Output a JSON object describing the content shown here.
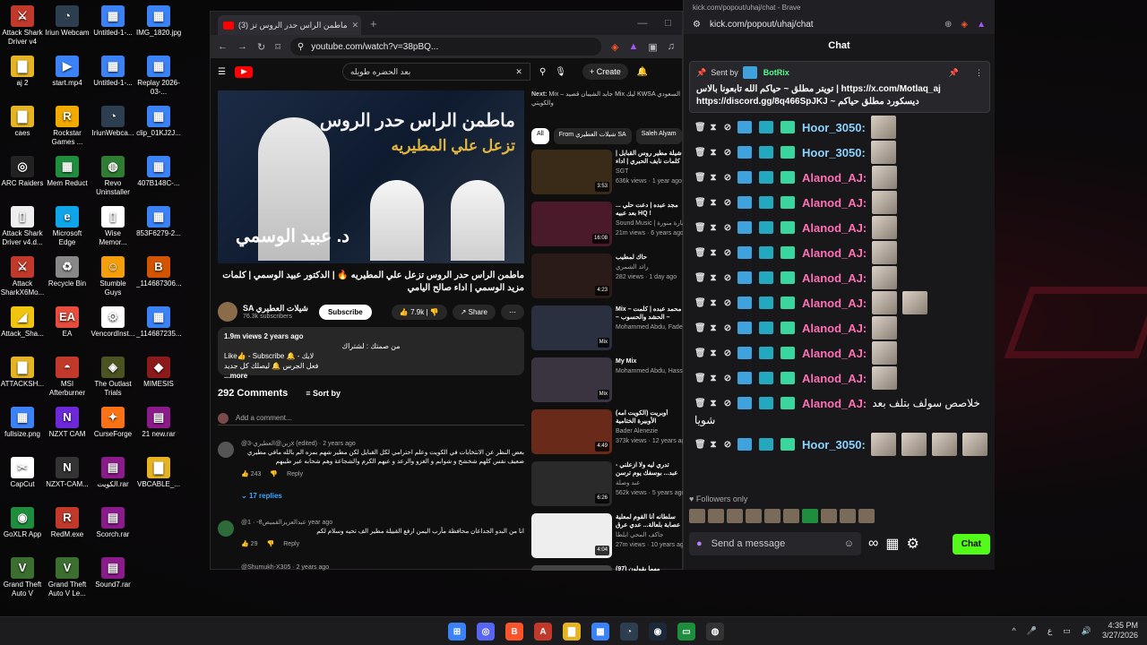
{
  "desktop": {
    "icons": [
      {
        "label": "Attack Shark Driver v4",
        "color": "#c0392b",
        "glyph": "⚔"
      },
      {
        "label": "aj 2",
        "color": "#e6b422",
        "glyph": "▇"
      },
      {
        "label": "caes",
        "color": "#e6b422",
        "glyph": "▇"
      },
      {
        "label": "ARC Raiders",
        "color": "#222",
        "glyph": "◎"
      },
      {
        "label": "Attack Shark Driver v4.d...",
        "color": "#eee",
        "glyph": "▯"
      },
      {
        "label": "Attack SharkX6Mo...",
        "color": "#c0392b",
        "glyph": "⚔"
      },
      {
        "label": "Attack_Sha...",
        "color": "#f1c40f",
        "glyph": "◢"
      },
      {
        "label": "ATTACKSH...",
        "color": "#e6b422",
        "glyph": "▇"
      },
      {
        "label": "fullsize.png",
        "color": "#3b82f6",
        "glyph": "▦"
      },
      {
        "label": "CapCut",
        "color": "#fff",
        "glyph": "✂"
      },
      {
        "label": "GoXLR App",
        "color": "#1e8e3e",
        "glyph": "◉"
      },
      {
        "label": "Grand Theft Auto V",
        "color": "#3b6e2f",
        "glyph": "V"
      },
      {
        "label": "Iriun Webcam",
        "color": "#2c3e50",
        "glyph": "◔"
      },
      {
        "label": "start.mp4",
        "color": "#3b82f6",
        "glyph": "▶"
      },
      {
        "label": "Rockstar Games ...",
        "color": "#f2a900",
        "glyph": "R"
      },
      {
        "label": "Mem Reduct",
        "color": "#1e8e3e",
        "glyph": "▦"
      },
      {
        "label": "Microsoft Edge",
        "color": "#0ea5e9",
        "glyph": "e"
      },
      {
        "label": "Recycle Bin",
        "color": "#888",
        "glyph": "♻"
      },
      {
        "label": "EA",
        "color": "#e74c3c",
        "glyph": "EA"
      },
      {
        "label": "MSI Afterburner",
        "color": "#c0392b",
        "glyph": "◓"
      },
      {
        "label": "NZXT CAM",
        "color": "#6d28d9",
        "glyph": "N"
      },
      {
        "label": "NZXT-CAM...",
        "color": "#333",
        "glyph": "N"
      },
      {
        "label": "RedM.exe",
        "color": "#c0392b",
        "glyph": "R"
      },
      {
        "label": "Grand Theft Auto V Le...",
        "color": "#3b6e2f",
        "glyph": "V"
      },
      {
        "label": "Untitled-1-...",
        "color": "#3b82f6",
        "glyph": "▦"
      },
      {
        "label": "Untitled-1-...",
        "color": "#3b82f6",
        "glyph": "▦"
      },
      {
        "label": "IriunWebca...",
        "color": "#2c3e50",
        "glyph": "◔"
      },
      {
        "label": "Revo Uninstaller",
        "color": "#2e7d32",
        "glyph": "◍"
      },
      {
        "label": "Wise Memor...",
        "color": "#fff",
        "glyph": "▯"
      },
      {
        "label": "Stumble Guys",
        "color": "#f59e0b",
        "glyph": "☺"
      },
      {
        "label": "VencordInst...",
        "color": "#fff",
        "glyph": "⚙"
      },
      {
        "label": "The Outlast Trials",
        "color": "#4b5320",
        "glyph": "◈"
      },
      {
        "label": "CurseForge",
        "color": "#f97316",
        "glyph": "✦"
      },
      {
        "label": "الكويت.rar",
        "color": "#8b1a8b",
        "glyph": "▤"
      },
      {
        "label": "Scorch.rar",
        "color": "#8b1a8b",
        "glyph": "▤"
      },
      {
        "label": "Sound7.rar",
        "color": "#8b1a8b",
        "glyph": "▤"
      },
      {
        "label": "IMG_1820.jpg",
        "color": "#3b82f6",
        "glyph": "▦"
      },
      {
        "label": "Replay 2026-03-...",
        "color": "#3b82f6",
        "glyph": "▦"
      },
      {
        "label": "clip_01KJ2J...",
        "color": "#3b82f6",
        "glyph": "▦"
      },
      {
        "label": "407B148C-...",
        "color": "#3b82f6",
        "glyph": "▦"
      },
      {
        "label": "853F6279-2...",
        "color": "#3b82f6",
        "glyph": "▦"
      },
      {
        "label": "_114687306...",
        "color": "#d35400",
        "glyph": "B"
      },
      {
        "label": "_114687235...",
        "color": "#3b82f6",
        "glyph": "▦"
      },
      {
        "label": "MIMESIS",
        "color": "#8b1a1a",
        "glyph": "◆"
      },
      {
        "label": "21 new.rar",
        "color": "#8b1a8b",
        "glyph": "▤"
      },
      {
        "label": "VBCABLE_...",
        "color": "#e6b422",
        "glyph": "▇"
      }
    ]
  },
  "youtube": {
    "tab_title": "(3) ماطمن الراس حدر الروس تز",
    "url": "youtube.com/watch?v=38pBQ...",
    "search_query": "بعد الحضره طويله",
    "create_label": "Create",
    "thumb_title_line1": "ماطمن الراس حدر الروس",
    "thumb_title_line2": "تزعل علي المطيريه",
    "thumb_name": "د. عبيد الوسمي",
    "video_title": "ماطمن الراس حدر الروس تزعل علي المطيريه 🔥 | الدكتور عبيد الوسمي | كلمات مزيد الوسمي | اداء صالح اليامي",
    "channel_name": "SA شيلات العطيري",
    "subscribers": "76.3k subscribers",
    "subscribe_label": "Subscribe",
    "likes": "7.9k",
    "share_label": "Share",
    "desc_views": "1.9m views  2 years ago",
    "desc_line1": "من صمتك : لشتراك",
    "desc_line2": "Like👍 - Subscribe 🔔 - لايك",
    "desc_line3": "فعل الجرس  🔔 ليصلك كل جديد",
    "desc_more": "...more",
    "comments_count": "292 Comments",
    "sort_label": "Sort by",
    "add_comment": "Add a comment...",
    "comments": [
      {
        "name": "@زبن@العطيري-3x (edited)",
        "time": "2 years ago",
        "text": "بعض النظر عن الانتخابات في الكويت وعلم احترامي لكل القبايل لكن مطير شهم بمزه الم بالله مافي مطيري ضعيف نفس كلهم شخشخ و شوابم و  الغزو والرعد و عيهم الكرم والشجاعة وهم شحابه عير طيبهم",
        "likes": "243",
        "reply": "Reply",
        "replies": "17 replies"
      },
      {
        "name": "@عبدالعزيزالقميص8-",
        "time": "1 year ago",
        "text": "انا من البدو الجداعان محافظة مأرب اليمن ارفع القبيلة مطير الف تحيه وسلام لكم",
        "likes": "29",
        "reply": "Reply"
      },
      {
        "name": "@Shumukh-X305",
        "time": "2 years ago",
        "text": "",
        "likes": "",
        "reply": ""
      }
    ],
    "next_label": "Next:",
    "next_title": "Mix – جابد الشيبان قصيد Mix ليك KWSA السعودي والكويتي",
    "chips": [
      "All",
      "From شيلات العطيري SA",
      "Saleh Alyam"
    ],
    "sidebar_videos": [
      {
        "title": "شيلة مطير روس القبايل | كلمات نايف الحبري | اداء صالح اليامي",
        "channel": "SGT",
        "meta": "636k views · 1 year ago",
        "dur": "3:53",
        "color": "#3a2a18"
      },
      {
        "title": "مجد عبده | دعت حلي ... بعد عبيه HQ !",
        "channel": "Sound Music | سارة منورة",
        "meta": "21m views · 6 years ago",
        "dur": "16:08",
        "color": "#4a1a2a"
      },
      {
        "title": "حاك لمطيب",
        "channel": "رائد الشمري",
        "meta": "282 views · 1 day ago",
        "dur": "4:23",
        "color": "#2a1a18"
      },
      {
        "title": "Mix – محمد عبده | كلمت – الحشد والحسوب – مرجح الحروف H",
        "channel": "Mohammed Abdu, Fadel ...",
        "meta": "",
        "dur": "Mix",
        "color": "#2a3040"
      },
      {
        "title": "My Mix",
        "channel": "Mohammed Abdu, Hassan ...",
        "meta": "",
        "dur": "Mix",
        "color": "#3a3440"
      },
      {
        "title": "أوبريت (الكويت امه) الأوبيرة الختامية",
        "channel": "Bader Alenezie",
        "meta": "373k views · 12 years ago",
        "dur": "4:49",
        "color": "#6a2a1a"
      },
      {
        "title": "تدري ليه ولا ازعلني - عبد... بوسفك يوم ترسن",
        "channel": "عبد وصلة",
        "meta": "562k views · 5 years ago",
        "dur": "6:26",
        "color": "#2a2a2a"
      },
      {
        "title": "سلطانه أنا القوم لمعلية عصابة بلعالة... عدي عرق",
        "channel": "جاكف المحي ايلطا",
        "meta": "27m views · 10 years ago",
        "dur": "4:04",
        "color": "#eee"
      },
      {
        "title": "(97) مهما يقولون",
        "channel": "",
        "meta": "",
        "dur": "",
        "color": "#444"
      }
    ]
  },
  "kick": {
    "window_title": "kick.com/popout/uhaj/chat - Brave",
    "url": "kick.com/popout/uhaj/chat",
    "header": "Chat",
    "pinned_by": "Sent by",
    "pinned_bot": "BotRix",
    "pinned_line1": "تويتر مطلق ~ حياكم الله تابعونا بالاس | https://x.com/Motlaq_aj",
    "pinned_line2": "https://discord.gg/8q466SpJKJ ~ ديسكورد مطلق حياكم",
    "messages": [
      {
        "user": "Hoor_3050:",
        "color": "#8ad3ff",
        "emotes": 1,
        "text": ""
      },
      {
        "user": "Hoor_3050:",
        "color": "#8ad3ff",
        "emotes": 1,
        "text": ""
      },
      {
        "user": "Alanod_AJ:",
        "color": "#ff6fb5",
        "emotes": 1,
        "text": ""
      },
      {
        "user": "Alanod_AJ:",
        "color": "#ff6fb5",
        "emotes": 1,
        "text": ""
      },
      {
        "user": "Alanod_AJ:",
        "color": "#ff6fb5",
        "emotes": 1,
        "text": ""
      },
      {
        "user": "Alanod_AJ:",
        "color": "#ff6fb5",
        "emotes": 1,
        "text": ""
      },
      {
        "user": "Alanod_AJ:",
        "color": "#ff6fb5",
        "emotes": 1,
        "text": ""
      },
      {
        "user": "Alanod_AJ:",
        "color": "#ff6fb5",
        "emotes": 2,
        "text": ""
      },
      {
        "user": "Alanod_AJ:",
        "color": "#ff6fb5",
        "emotes": 1,
        "text": ""
      },
      {
        "user": "Alanod_AJ:",
        "color": "#ff6fb5",
        "emotes": 1,
        "text": ""
      },
      {
        "user": "Alanod_AJ:",
        "color": "#ff6fb5",
        "emotes": 1,
        "text": ""
      },
      {
        "user": "Alanod_AJ:",
        "color": "#ff6fb5",
        "emotes": 0,
        "text": "خلاصص سولف بتلف بعد"
      }
    ],
    "wrap_text": "شويا",
    "last_user": "Hoor_3050:",
    "followers_only": "Followers only",
    "send_placeholder": "Send a message",
    "chat_button": "Chat",
    "accent": "#53fc18"
  },
  "taskbar": {
    "time": "4:35 PM",
    "date": "3/27/2026",
    "lang": "ع"
  }
}
